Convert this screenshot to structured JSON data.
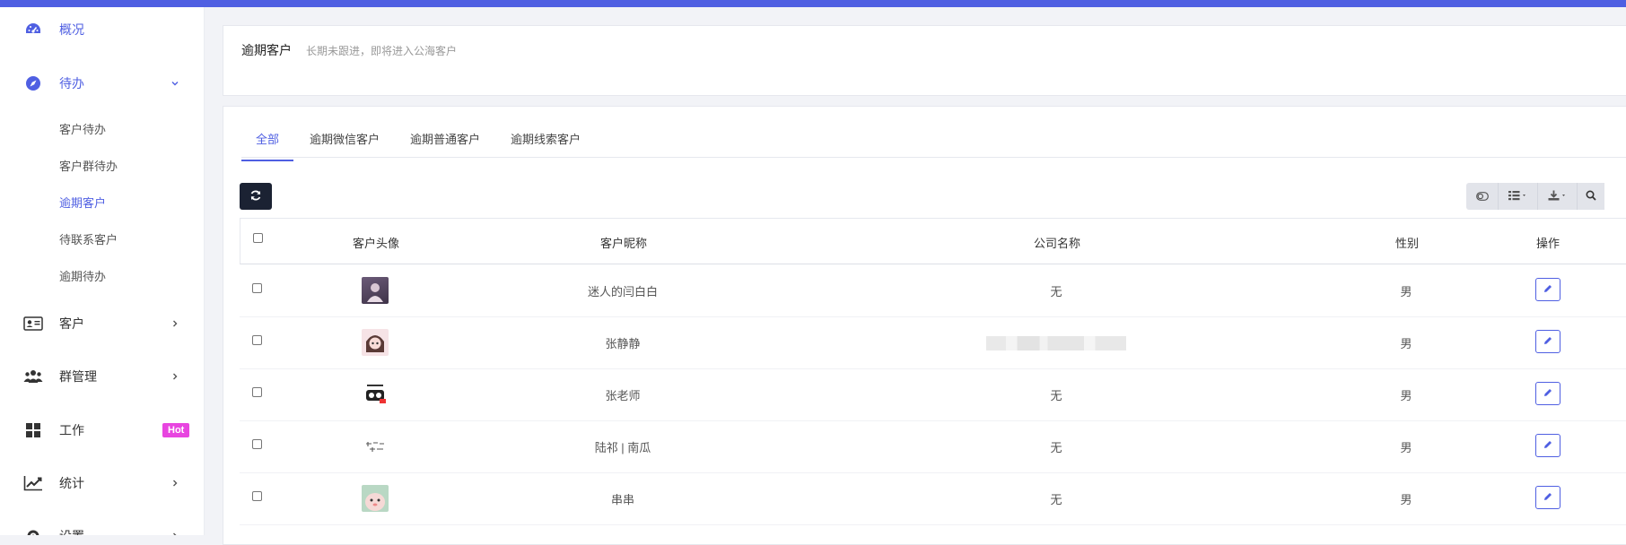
{
  "sidebar": {
    "items": [
      {
        "label": "概况",
        "icon": "dashboard-icon",
        "active": true
      },
      {
        "label": "待办",
        "icon": "compass-icon",
        "active": true,
        "children": [
          {
            "label": "客户待办"
          },
          {
            "label": "客户群待办"
          },
          {
            "label": "逾期客户",
            "active": true
          },
          {
            "label": "待联系客户"
          },
          {
            "label": "逾期待办"
          }
        ]
      },
      {
        "label": "客户",
        "icon": "contact-card-icon"
      },
      {
        "label": "群管理",
        "icon": "group-icon"
      },
      {
        "label": "工作",
        "icon": "grid-icon",
        "badge": "Hot"
      },
      {
        "label": "统计",
        "icon": "chart-line-icon"
      },
      {
        "label": "设置",
        "icon": "gear-icon"
      }
    ]
  },
  "header_card": {
    "title": "逾期客户",
    "subtitle": "长期未跟进，即将进入公海客户"
  },
  "tabs": [
    {
      "label": "全部",
      "active": true
    },
    {
      "label": "逾期微信客户"
    },
    {
      "label": "逾期普通客户"
    },
    {
      "label": "逾期线索客户"
    }
  ],
  "table": {
    "columns": [
      "客户头像",
      "客户昵称",
      "公司名称",
      "性别",
      "操作"
    ],
    "rows": [
      {
        "nickname": "迷人的闫白白",
        "company": "无",
        "gender": "男"
      },
      {
        "nickname": "张静静",
        "company": "",
        "gender": "男"
      },
      {
        "nickname": "张老师",
        "company": "无",
        "gender": "男"
      },
      {
        "nickname": "陆祁 | 南瓜",
        "company": "无",
        "gender": "男"
      },
      {
        "nickname": "串串",
        "company": "无",
        "gender": "男"
      }
    ]
  },
  "colors": {
    "accent": "#4f5fe2",
    "hot_badge": "#e845e0",
    "dark_button": "#1b2233"
  }
}
